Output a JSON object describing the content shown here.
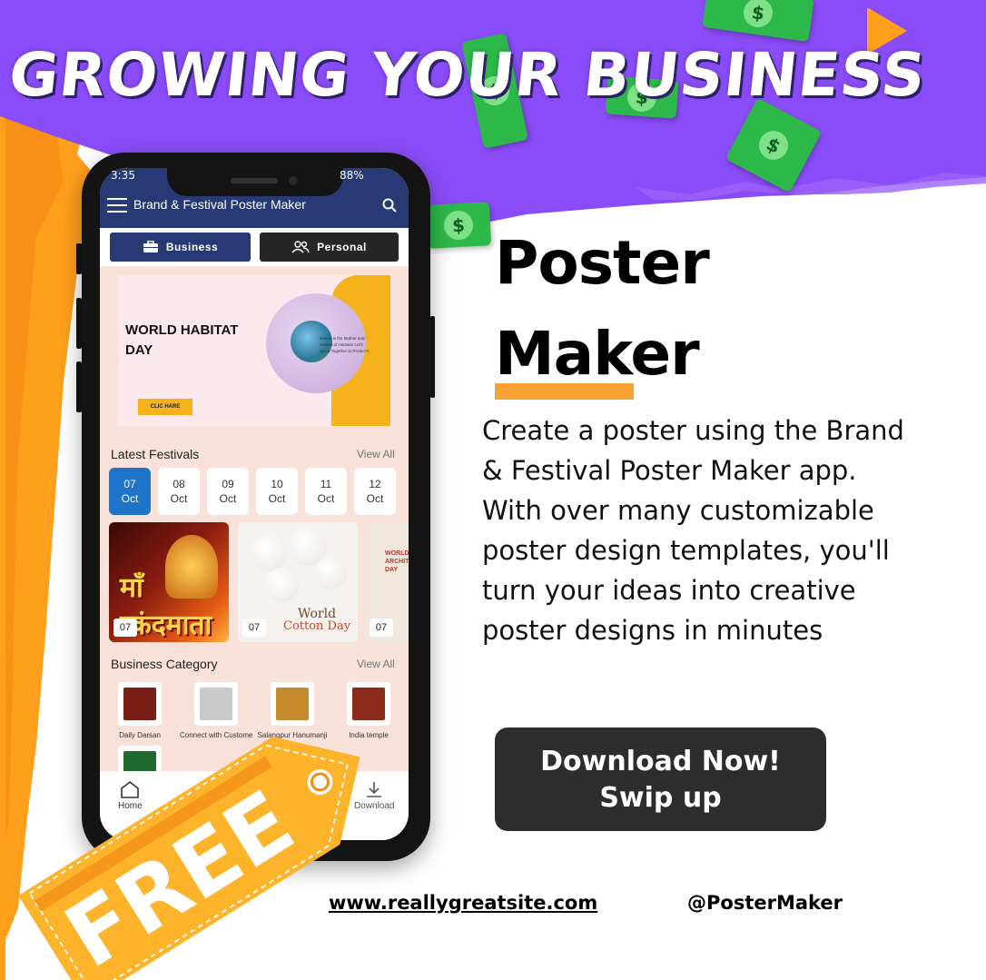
{
  "headline": "GROWING YOUR BUSINESS",
  "colors": {
    "purple": "#8a4cf8",
    "orange": "#ff9f1c",
    "navy": "#283a75",
    "dark_button": "#2d2d2d",
    "accent_underline": "#f7a233"
  },
  "phone": {
    "status_time": "3:35",
    "status_battery": "88%",
    "app_title": "Brand & Festival Poster Maker",
    "tabs": [
      {
        "label": "Business",
        "icon": "briefcase-icon"
      },
      {
        "label": "Personal",
        "icon": "people-icon"
      }
    ],
    "banner": {
      "title": "WORLD HABITAT DAY",
      "button": "CLIC HARE",
      "tagline": "Nature is the Mother and Habitat of Humans Let's Strive Together to Protect It."
    },
    "festivals": {
      "title": "Latest Festivals",
      "view_all": "View All",
      "dates": [
        {
          "day": "07",
          "month": "Oct"
        },
        {
          "day": "08",
          "month": "Oct"
        },
        {
          "day": "09",
          "month": "Oct"
        },
        {
          "day": "10",
          "month": "Oct"
        },
        {
          "day": "11",
          "month": "Oct"
        },
        {
          "day": "12",
          "month": "Oct"
        }
      ],
      "cards": [
        {
          "badge": "07",
          "text": "माँ स्कंदमाता"
        },
        {
          "badge": "07",
          "text": "World",
          "text2": "Cotton Day"
        },
        {
          "badge": "07",
          "text": "WORLD ARCHITECTURE DAY"
        }
      ]
    },
    "business": {
      "title": "Business Category",
      "view_all": "View All",
      "items": [
        "Daily Darsan",
        "Connect with Customers",
        "Salangpur Hanumanji",
        "India temple"
      ]
    },
    "nav": {
      "home": "Home",
      "download": "Download"
    }
  },
  "free_label": "FREE",
  "title_line1": "Poster",
  "title_line2": "Maker",
  "description": "Create a poster using the Brand & Festival Poster Maker app. With over many customizable poster design templates, you'll turn your ideas into creative poster designs in minutes",
  "cta_line1": "Download Now!",
  "cta_line2": "Swip up",
  "website": "www.reallygreatsite.com",
  "handle": "@PosterMaker"
}
